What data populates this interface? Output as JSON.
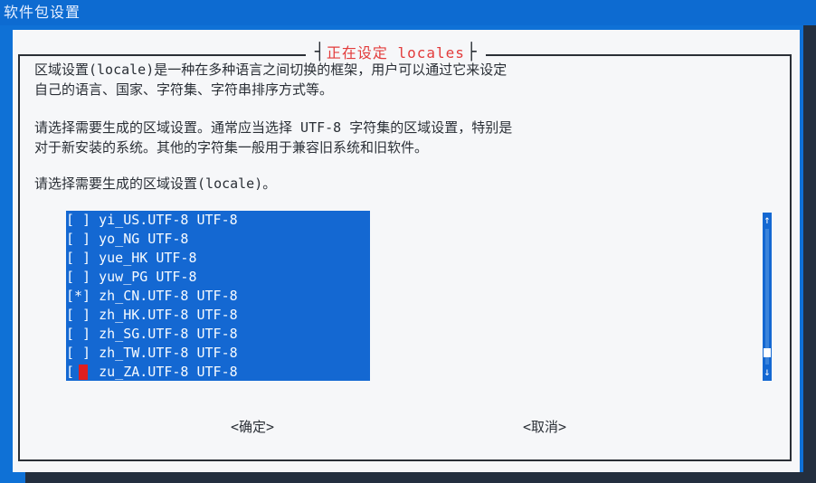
{
  "window": {
    "title": "软件包设置"
  },
  "dialog": {
    "title": "正在设定 locales",
    "description_lines": [
      "区域设置(locale)是一种在多种语言之间切换的框架，用户可以通过它来设定",
      "自己的语言、国家、字符集、字符串排序方式等。",
      "",
      "请选择需要生成的区域设置。通常应当选择 UTF-8 字符集的区域设置，特别是",
      "对于新安装的系统。其他的字符集一般用于兼容旧系统和旧软件。",
      "",
      "请选择需要生成的区域设置(locale)。"
    ],
    "list": [
      "[ ] yi_US.UTF-8 UTF-8",
      "[ ] yo_NG UTF-8",
      "[ ] yue_HK UTF-8",
      "[ ] yuw_PG UTF-8",
      "[*] zh_CN.UTF-8 UTF-8",
      "[ ] zh_HK.UTF-8 UTF-8",
      "[ ] zh_SG.UTF-8 UTF-8",
      "[ ] zh_TW.UTF-8 UTF-8",
      "[ ] zu_ZA.UTF-8 UTF-8"
    ],
    "ok_label": "<确定>",
    "cancel_label": "<取消>",
    "scroll_up": "↑",
    "scroll_down": "↓"
  },
  "colors": {
    "accent": "#0f71d6",
    "list_bg": "#1468d2",
    "title_text": "#e23b3b",
    "cursor": "#e01f1f"
  }
}
